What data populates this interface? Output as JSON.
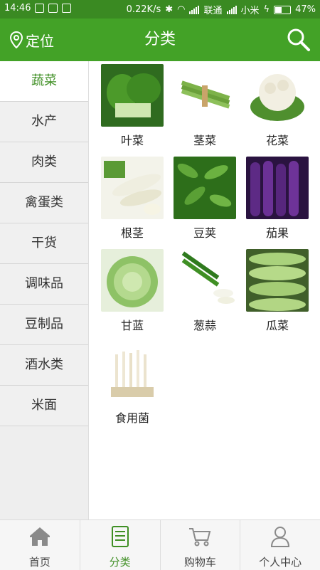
{
  "status_bar": {
    "time": "14:46",
    "speed": "0.22K/s",
    "carrier1": "联通",
    "carrier2": "小米",
    "battery": "47%"
  },
  "header": {
    "location_label": "定位",
    "title": "分类",
    "icons": [
      "location-pin-icon",
      "search-icon"
    ]
  },
  "sidebar": {
    "items": [
      {
        "label": "蔬菜",
        "active": true
      },
      {
        "label": "水产"
      },
      {
        "label": "肉类"
      },
      {
        "label": "禽蛋类"
      },
      {
        "label": "干货"
      },
      {
        "label": "调味品"
      },
      {
        "label": "豆制品"
      },
      {
        "label": "酒水类"
      },
      {
        "label": "米面"
      }
    ]
  },
  "grid": {
    "items": [
      {
        "label": "叶菜"
      },
      {
        "label": "茎菜"
      },
      {
        "label": "花菜"
      },
      {
        "label": "根茎"
      },
      {
        "label": "豆荚"
      },
      {
        "label": "茄果"
      },
      {
        "label": "甘蓝"
      },
      {
        "label": "葱蒜"
      },
      {
        "label": "瓜菜"
      },
      {
        "label": "食用菌"
      }
    ]
  },
  "tabbar": {
    "tabs": [
      {
        "label": "首页",
        "icon": "home-icon"
      },
      {
        "label": "分类",
        "icon": "list-icon",
        "active": true
      },
      {
        "label": "购物车",
        "icon": "cart-icon"
      },
      {
        "label": "个人中心",
        "icon": "person-icon"
      }
    ]
  },
  "colors": {
    "brand_green": "#43a227",
    "active_text": "#3f8f24"
  }
}
